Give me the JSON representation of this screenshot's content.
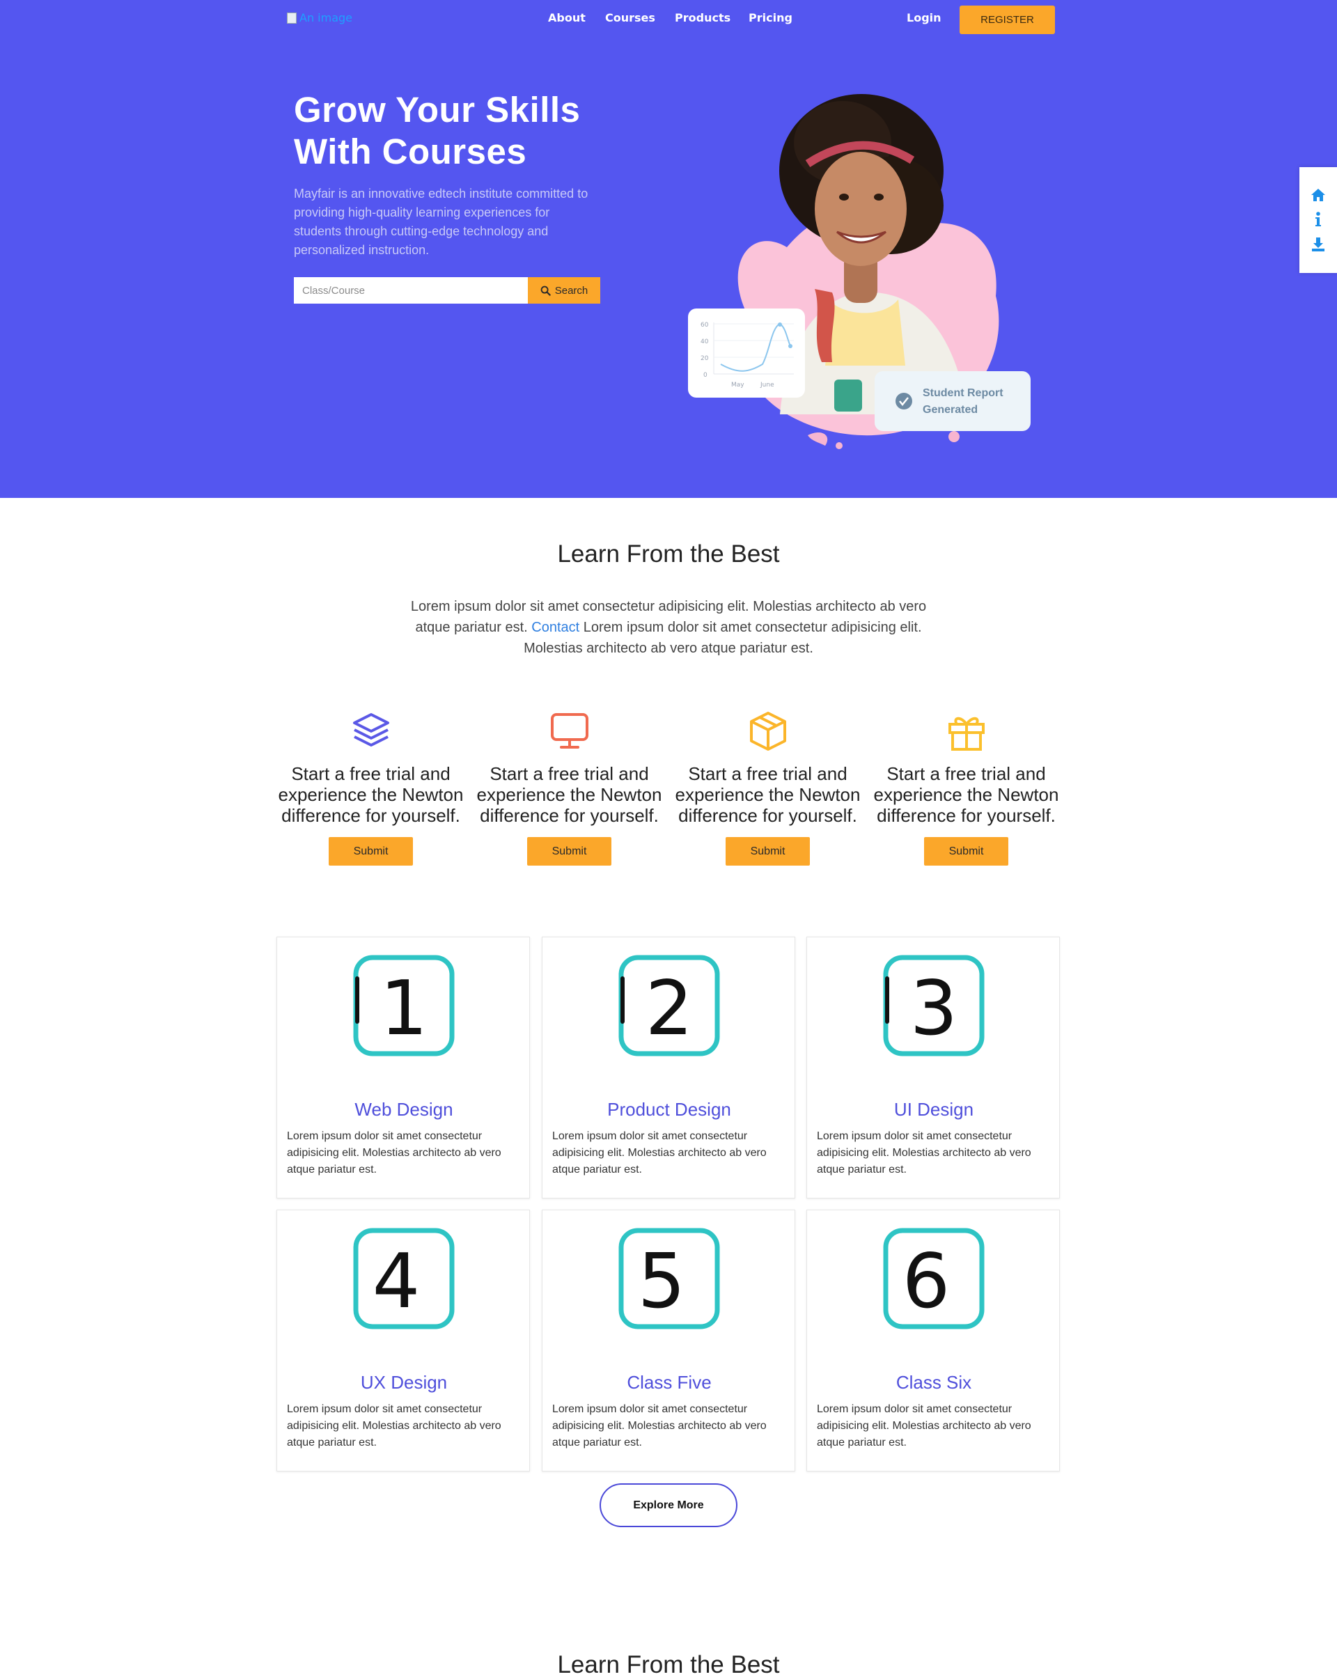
{
  "nav": {
    "logo_alt": "An image",
    "links": [
      "About",
      "Courses",
      "Products",
      "Pricing"
    ],
    "login": "Login",
    "register": "REGISTER"
  },
  "hero": {
    "title_line1": "Grow Your Skills",
    "title_line2": "With Courses",
    "description": "Mayfair is an innovative edtech institute committed to providing high-quality learning experiences for students through cutting-edge technology and personalized instruction.",
    "search_placeholder": "Class/Course",
    "search_button": "Search",
    "chart_ticks": [
      "60",
      "40",
      "20",
      "0"
    ],
    "chart_months": [
      "May",
      "June"
    ],
    "report_line1": "Student Report",
    "report_line2": "Generated"
  },
  "side_icons": [
    "home-icon",
    "info-icon",
    "download-icon"
  ],
  "learn": {
    "title": "Learn From the Best",
    "intro_part1": "Lorem ipsum dolor sit amet consectetur adipisicing elit. Molestias architecto ab vero atque pariatur est.",
    "intro_link": "Contact",
    "intro_part2": "Lorem ipsum dolor sit amet consectetur adipisicing elit. Molestias architecto ab vero atque pariatur est."
  },
  "features": [
    {
      "icon": "layers-icon",
      "text": "Start a free trial and experience the Newton difference for yourself.",
      "button": "Submit",
      "color": "#5a58e6"
    },
    {
      "icon": "monitor-icon",
      "text": "Start a free trial and experience the Newton difference for yourself.",
      "button": "Submit",
      "color": "#f06a4f"
    },
    {
      "icon": "box-icon",
      "text": "Start a free trial and experience the Newton difference for yourself.",
      "button": "Submit",
      "color": "#fbb52a"
    },
    {
      "icon": "gift-icon",
      "text": "Start a free trial and experience the Newton difference for yourself.",
      "button": "Submit",
      "color": "#fbc02d"
    }
  ],
  "courses": [
    {
      "number": "1",
      "title": "Web Design",
      "desc": "Lorem ipsum dolor sit amet consectetur adipisicing elit. Molestias architecto ab vero atque pariatur est."
    },
    {
      "number": "2",
      "title": "Product Design",
      "desc": "Lorem ipsum dolor sit amet consectetur adipisicing elit. Molestias architecto ab vero atque pariatur est."
    },
    {
      "number": "3",
      "title": "UI Design",
      "desc": "Lorem ipsum dolor sit amet consectetur adipisicing elit. Molestias architecto ab vero atque pariatur est."
    },
    {
      "number": "4",
      "title": "UX Design",
      "desc": "Lorem ipsum dolor sit amet consectetur adipisicing elit. Molestias architecto ab vero atque pariatur est."
    },
    {
      "number": "5",
      "title": "Class Five",
      "desc": "Lorem ipsum dolor sit amet consectetur adipisicing elit. Molestias architecto ab vero atque pariatur est."
    },
    {
      "number": "6",
      "title": "Class Six",
      "desc": "Lorem ipsum dolor sit amet consectetur adipisicing elit. Molestias architecto ab vero atque pariatur est."
    }
  ],
  "explore_button": "Explore More",
  "second_title": "Learn From the Best",
  "colors": {
    "hero_bg": "#5456f0",
    "accent": "#fba72a",
    "teal": "#2ec4c4",
    "course_title": "#4f4fdb"
  }
}
